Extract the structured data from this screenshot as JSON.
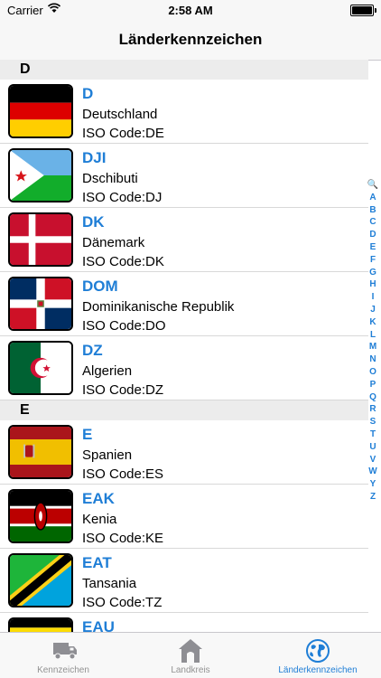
{
  "status": {
    "carrier": "Carrier",
    "time": "2:58 AM"
  },
  "nav": {
    "title": "Länderkennzeichen"
  },
  "sections": [
    {
      "letter": "D",
      "rows": [
        {
          "code": "D",
          "name": "Deutschland",
          "iso": "ISO Code:DE"
        },
        {
          "code": "DJI",
          "name": "Dschibuti",
          "iso": "ISO Code:DJ"
        },
        {
          "code": "DK",
          "name": "Dänemark",
          "iso": "ISO Code:DK"
        },
        {
          "code": "DOM",
          "name": "Dominikanische Republik",
          "iso": "ISO Code:DO"
        },
        {
          "code": "DZ",
          "name": "Algerien",
          "iso": "ISO Code:DZ"
        }
      ]
    },
    {
      "letter": "E",
      "rows": [
        {
          "code": "E",
          "name": "Spanien",
          "iso": "ISO Code:ES"
        },
        {
          "code": "EAK",
          "name": "Kenia",
          "iso": "ISO Code:KE"
        },
        {
          "code": "EAT",
          "name": "Tansania",
          "iso": "ISO Code:TZ"
        },
        {
          "code": "EAU",
          "name": "",
          "iso": ""
        }
      ]
    }
  ],
  "index": [
    "🔍",
    "A",
    "B",
    "C",
    "D",
    "E",
    "F",
    "G",
    "H",
    "I",
    "J",
    "K",
    "L",
    "M",
    "N",
    "O",
    "P",
    "Q",
    "R",
    "S",
    "T",
    "U",
    "V",
    "W",
    "Y",
    "Z"
  ],
  "tabs": [
    {
      "label": "Kennzeichen",
      "icon": "truck-icon"
    },
    {
      "label": "Landkreis",
      "icon": "house-icon"
    },
    {
      "label": "Länderkennzeichen",
      "icon": "globe-icon"
    }
  ],
  "colors": {
    "accent": "#1f7ed6",
    "inactive": "#929292"
  }
}
